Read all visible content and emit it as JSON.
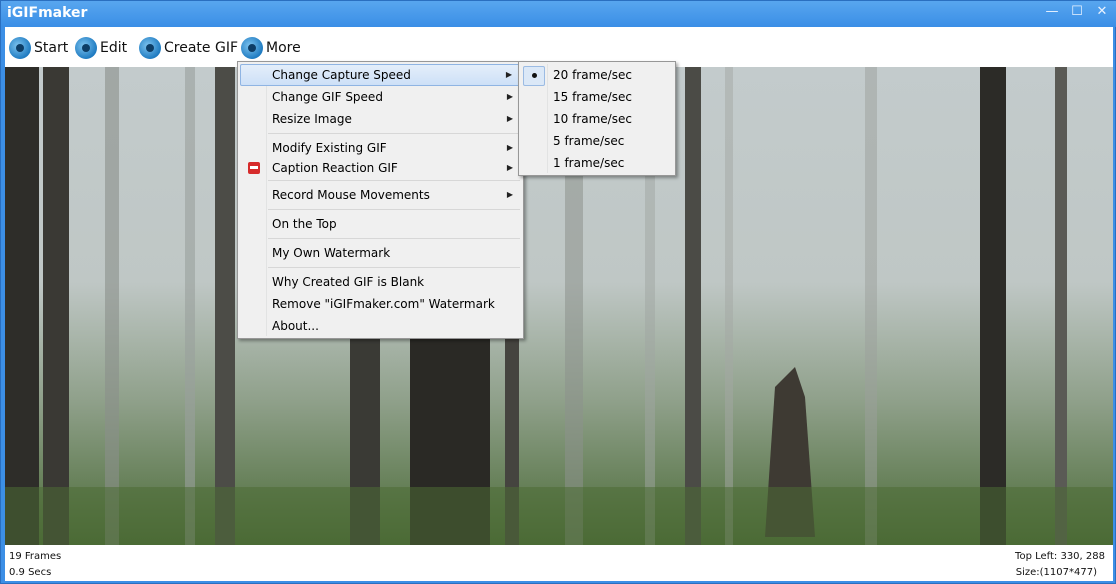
{
  "window": {
    "title": "iGIFmaker"
  },
  "toolbar": {
    "items": [
      {
        "label": "Start",
        "icon": "record-icon"
      },
      {
        "label": "Edit",
        "icon": "wrench-icon"
      },
      {
        "label": "Create GIF",
        "icon": "redo-arrow-icon"
      },
      {
        "label": "More",
        "icon": "gear-icon"
      }
    ]
  },
  "more_menu": {
    "items": [
      {
        "label": "Change Capture Speed",
        "submenu": true,
        "highlighted": true
      },
      {
        "label": "Change GIF Speed",
        "submenu": true
      },
      {
        "label": "Resize Image",
        "submenu": true
      },
      {
        "label": "Modify Existing GIF",
        "submenu": true
      },
      {
        "label": "Caption Reaction GIF",
        "submenu": true,
        "icon": "caption-icon"
      },
      {
        "label": "Record Mouse Movements",
        "submenu": true
      },
      {
        "label": "On the Top"
      },
      {
        "label": "My Own Watermark"
      },
      {
        "label": "Why Created GIF is Blank"
      },
      {
        "label": "Remove \"iGIFmaker.com\" Watermark"
      },
      {
        "label": "About..."
      }
    ]
  },
  "speed_submenu": {
    "items": [
      {
        "label": "20 frame/sec",
        "selected": true
      },
      {
        "label": "15 frame/sec"
      },
      {
        "label": "10 frame/sec"
      },
      {
        "label": "5 frame/sec"
      },
      {
        "label": "1 frame/sec"
      }
    ]
  },
  "status": {
    "frames": "19 Frames",
    "duration": "0.9 Secs",
    "top_left": "Top Left: 330, 288",
    "size": "Size:(1107*477)"
  },
  "colors": {
    "chrome": "#3c8fe6",
    "menu_bg": "#f0f0f0",
    "highlight": "#cde0f7"
  }
}
